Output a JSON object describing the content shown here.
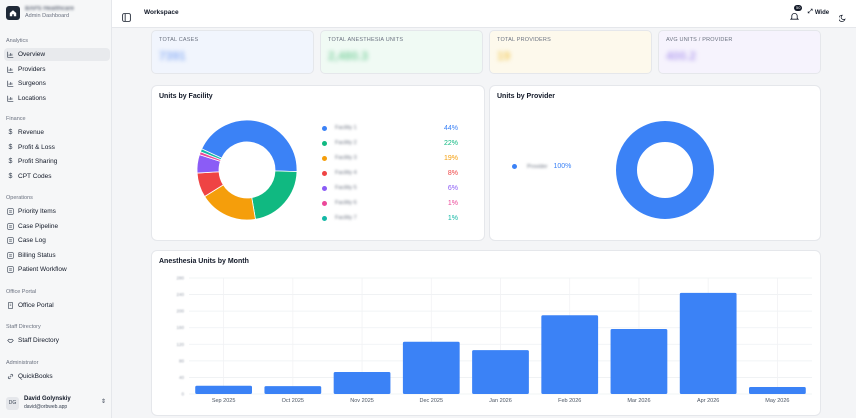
{
  "brand": {
    "name": "BAPS Healthcare",
    "subtitle": "Admin Dashboard"
  },
  "sidebar": {
    "sections": [
      {
        "title": "Analytics",
        "items": [
          {
            "label": "Overview",
            "icon": "chart-icon",
            "active": true
          },
          {
            "label": "Providers",
            "icon": "chart-icon"
          },
          {
            "label": "Surgeons",
            "icon": "chart-icon"
          },
          {
            "label": "Locations",
            "icon": "chart-icon"
          }
        ]
      },
      {
        "title": "Finance",
        "items": [
          {
            "label": "Revenue",
            "icon": "dollar-icon"
          },
          {
            "label": "Profit & Loss",
            "icon": "dollar-icon"
          },
          {
            "label": "Profit Sharing",
            "icon": "dollar-icon"
          },
          {
            "label": "CPT Codes",
            "icon": "dollar-icon"
          }
        ]
      },
      {
        "title": "Operations",
        "items": [
          {
            "label": "Priority Items",
            "icon": "list-icon"
          },
          {
            "label": "Case Pipeline",
            "icon": "list-icon"
          },
          {
            "label": "Case Log",
            "icon": "list-icon"
          },
          {
            "label": "Billing Status",
            "icon": "list-icon"
          },
          {
            "label": "Patient Workflow",
            "icon": "list-icon"
          }
        ]
      },
      {
        "title": "Office Portal",
        "items": [
          {
            "label": "Office Portal",
            "icon": "building-icon"
          }
        ]
      },
      {
        "title": "Staff Directory",
        "items": [
          {
            "label": "Staff Directory",
            "icon": "handshake-icon"
          }
        ]
      },
      {
        "title": "Administrator",
        "items": [
          {
            "label": "QuickBooks",
            "icon": "link-icon"
          }
        ]
      }
    ]
  },
  "user": {
    "initials": "DG",
    "name": "David Golynskiy",
    "email": "david@orbweb.app"
  },
  "topbar": {
    "title": "Workspace",
    "notifications": "50",
    "wide_label": "Wide"
  },
  "stats": [
    {
      "label": "TOTAL CASES",
      "value": "7391",
      "bg": "#f1f5fd",
      "color": "#93b4f5"
    },
    {
      "label": "TOTAL ANESTHESIA UNITS",
      "value": "2,480.3",
      "bg": "#f0faf4",
      "color": "#86d4a6"
    },
    {
      "label": "TOTAL PROVIDERS",
      "value": "19",
      "bg": "#fdf9ec",
      "color": "#f3cf6b"
    },
    {
      "label": "AVG UNITS / PROVIDER",
      "value": "400.2",
      "bg": "#f6f3fd",
      "color": "#b8a6f0"
    }
  ],
  "units_by_facility": {
    "title": "Units by Facility",
    "chart_data": {
      "type": "pie",
      "slices": [
        {
          "name": "Facility 1",
          "value": 44,
          "label": "44%",
          "color": "#3b82f6"
        },
        {
          "name": "Facility 2",
          "value": 22,
          "label": "22%",
          "color": "#10b981"
        },
        {
          "name": "Facility 3",
          "value": 19,
          "label": "19%",
          "color": "#f59e0b"
        },
        {
          "name": "Facility 4",
          "value": 8,
          "label": "8%",
          "color": "#ef4444"
        },
        {
          "name": "Facility 5",
          "value": 6,
          "label": "6%",
          "color": "#8b5cf6"
        },
        {
          "name": "Facility 6",
          "value": 1,
          "label": "1%",
          "color": "#ec4899"
        },
        {
          "name": "Facility 7",
          "value": 1,
          "label": "1%",
          "color": "#14b8a6"
        }
      ]
    }
  },
  "units_by_provider": {
    "title": "Units by Provider",
    "chart_data": {
      "type": "pie",
      "slices": [
        {
          "name": "Provider",
          "value": 100,
          "label": "100%",
          "color": "#3b82f6"
        }
      ]
    }
  },
  "units_by_month": {
    "title": "Anesthesia Units by Month",
    "chart_data": {
      "type": "bar",
      "categories": [
        "Sep 2025",
        "Oct 2025",
        "Nov 2025",
        "Dec 2025",
        "Jan 2026",
        "Feb 2026",
        "Mar 2026",
        "Apr 2026",
        "May 2026"
      ],
      "values": [
        20,
        19,
        53,
        126,
        106,
        190,
        157,
        244,
        17
      ],
      "ylim": [
        0,
        280
      ],
      "yticks": [
        0,
        40,
        80,
        120,
        160,
        200,
        240,
        280
      ],
      "grid": true,
      "color": "#3b82f6"
    }
  }
}
